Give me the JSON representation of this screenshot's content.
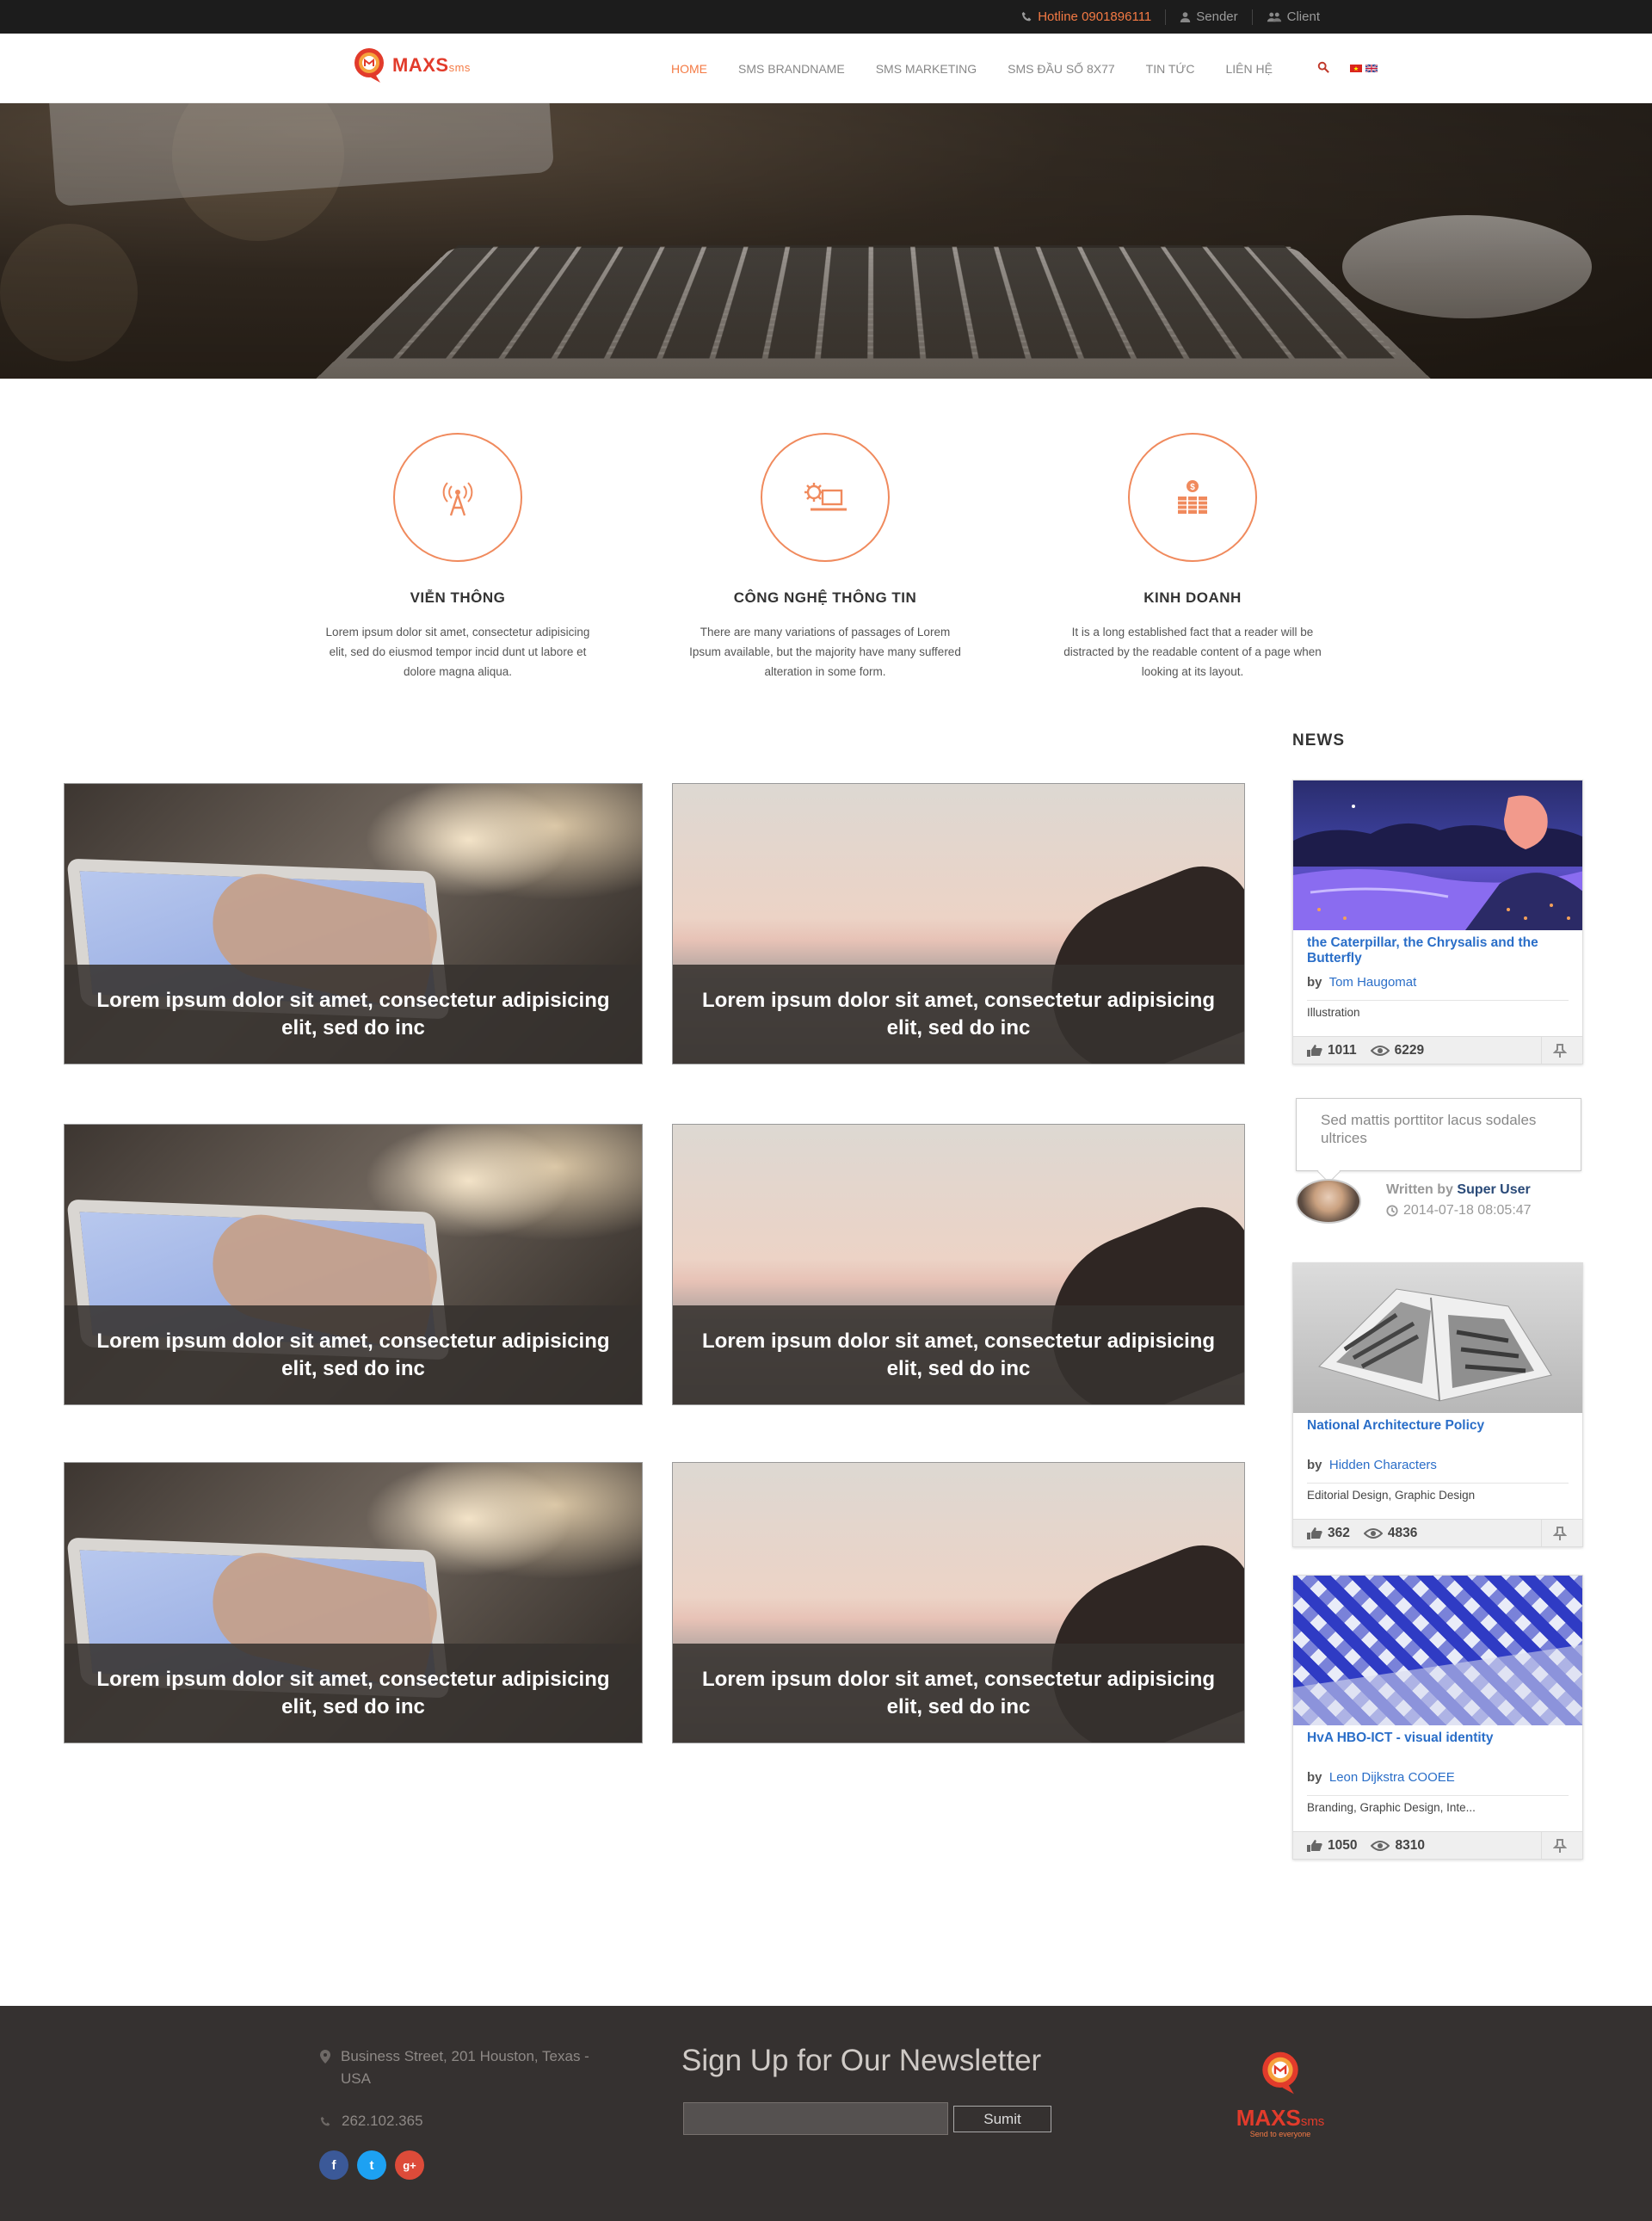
{
  "topbar": {
    "hotline": "Hotline 0901896111",
    "sender": "Sender",
    "client": "Client"
  },
  "brand": {
    "name": "MAXS",
    "suffix": "sms",
    "tagline": "Send to everyone"
  },
  "nav": {
    "items": [
      "HOME",
      "SMS BRANDNAME",
      "SMS MARKETING",
      "SMS ĐẦU SỐ 8X77",
      "TIN TỨC",
      "LIÊN HỆ"
    ],
    "active_index": 0
  },
  "features": [
    {
      "icon": "antenna-icon",
      "title": "VIỄN THÔNG",
      "text": "Lorem ipsum dolor sit amet, consectetur adipisicing elit, sed do eiusmod tempor incid dunt ut labore et dolore magna aliqua."
    },
    {
      "icon": "gear-laptop-icon",
      "title": "CÔNG NGHỆ THÔNG TIN",
      "text": "There are many variations of passages of Lorem Ipsum available, but the majority have many suffered alteration in some form."
    },
    {
      "icon": "money-icon",
      "title": "KINH DOANH",
      "text": "It is a long established fact that a reader will be distracted by the readable content of a page when looking at its layout."
    }
  ],
  "tiles": [
    {
      "caption": "Lorem ipsum dolor sit amet, consectetur adipisicing elit, sed do inc"
    },
    {
      "caption": "Lorem ipsum dolor sit amet, consectetur adipisicing elit, sed do inc"
    },
    {
      "caption": "Lorem ipsum dolor sit amet, consectetur adipisicing elit, sed do inc"
    },
    {
      "caption": "Lorem ipsum dolor sit amet, consectetur adipisicing elit, sed do inc"
    },
    {
      "caption": "Lorem ipsum dolor sit amet, consectetur adipisicing elit, sed do inc"
    },
    {
      "caption": "Lorem ipsum dolor sit amet, consectetur adipisicing elit, sed do inc"
    }
  ],
  "news": {
    "heading": "NEWS",
    "cards": [
      {
        "title": "the Caterpillar, the Chrysalis and the Butterfly",
        "by_label": "by",
        "author": "Tom Haugomat",
        "tags": "Illustration",
        "likes": "1011",
        "views": "6229"
      },
      {
        "title": "National Architecture Policy",
        "by_label": "by",
        "author": "Hidden Characters",
        "tags": "Editorial Design, Graphic Design",
        "likes": "362",
        "views": "4836"
      },
      {
        "title": "HvA HBO-ICT - visual identity",
        "by_label": "by",
        "author": "Leon Dijkstra COOEE",
        "tags": "Branding, Graphic Design, Inte...",
        "likes": "1050",
        "views": "8310"
      }
    ],
    "quote": {
      "text": "Sed mattis porttitor lacus sodales ultrices",
      "written_by_label": "Written by",
      "author": "Super User",
      "date": "2014-07-18 08:05:47"
    }
  },
  "footer": {
    "address": "Business Street, 201 Houston, Texas - USA",
    "phone": "262.102.365",
    "newsletter_title": "Sign Up for Our Newsletter",
    "newsletter_placeholder": "",
    "submit_label": "Sumit",
    "social": [
      "f",
      "t",
      "g+"
    ]
  },
  "colors": {
    "accent": "#f47a44",
    "link": "#2a6ec8",
    "footer_bg": "#353130",
    "topbar_bg": "#1c1c1c"
  }
}
